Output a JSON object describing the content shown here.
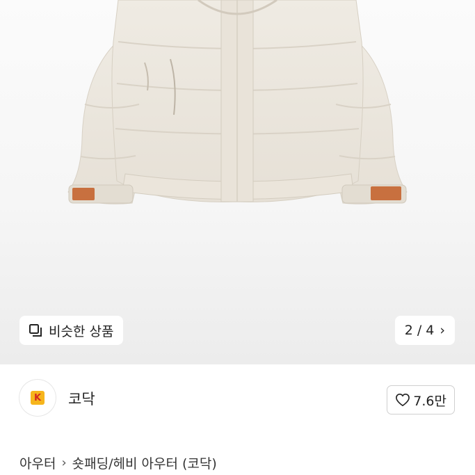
{
  "gallery": {
    "similar_label": "비슷한 상품",
    "page_indicator": "2 / 4",
    "chevron": "›"
  },
  "shop": {
    "name": "코닥",
    "logo_letter": "K",
    "like_count": "7.6만"
  },
  "breadcrumb": {
    "items": [
      "아우터",
      "숏패딩/헤비 아우터 (코닥)"
    ],
    "separator": "›"
  },
  "colors": {
    "jacket": "#ece7de",
    "leather_patch": "#c8703f",
    "kodak_yellow": "#f6b51c",
    "kodak_red": "#d42a1f"
  }
}
